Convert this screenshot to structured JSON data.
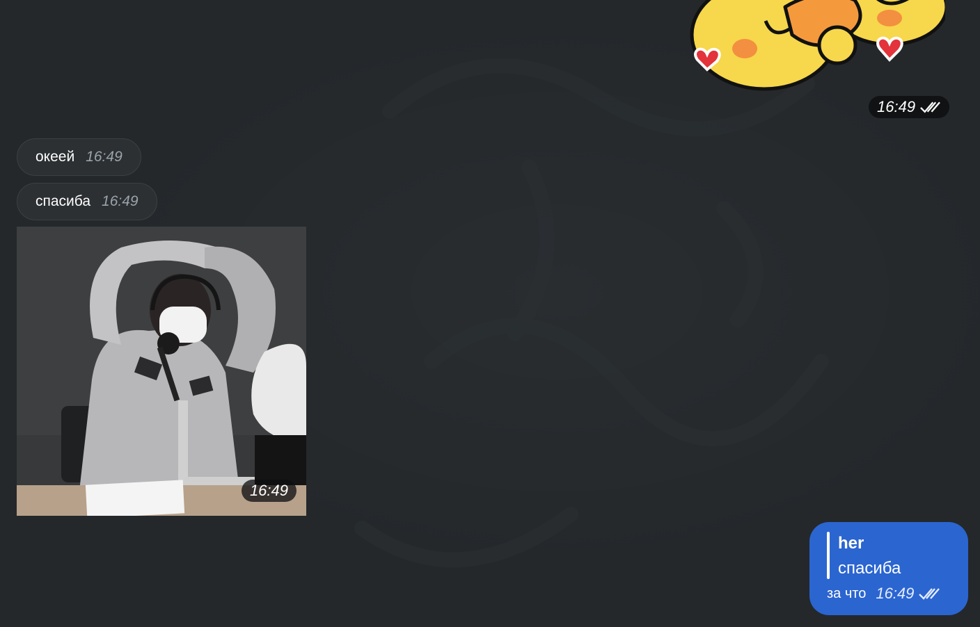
{
  "chat": {
    "sticker": {
      "icon": "sticker-hugging-chicks",
      "time": "16:49",
      "status_icon": "double-check-icon"
    },
    "incoming": [
      {
        "text": "океей",
        "time": "16:49"
      },
      {
        "text": "спасиба",
        "time": "16:49"
      }
    ],
    "photo": {
      "time": "16:49"
    },
    "outgoing": {
      "reply_author": "her",
      "reply_text": "спасиба",
      "text": "за что",
      "time": "16:49",
      "status_icon": "double-check-icon"
    }
  },
  "colors": {
    "background": "#24282b",
    "incoming_bubble": "#2c3033",
    "outgoing_bubble": "#2b65d0",
    "time_pill": "#0c0e10"
  }
}
